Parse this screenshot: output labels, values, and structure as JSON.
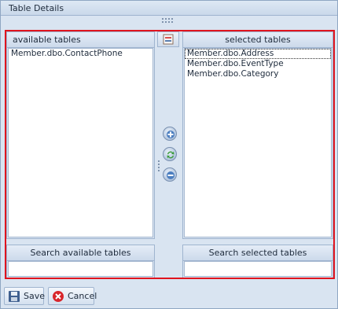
{
  "window": {
    "title": "Table Details"
  },
  "available": {
    "header": "available tables",
    "items": [
      "Member.dbo.ContactPhone"
    ],
    "search_header": "Search available tables",
    "search_value": ""
  },
  "selected": {
    "header": "selected tables",
    "items": [
      "Member.dbo.Address",
      "Member.dbo.EventType",
      "Member.dbo.Category"
    ],
    "search_header": "Search selected tables",
    "search_value": ""
  },
  "toolbar": {
    "save_label": "Save",
    "cancel_label": "Cancel"
  },
  "icons": {
    "top_button": "list-settings-icon",
    "add": "add-circle-icon",
    "swap": "swap-arrows-icon",
    "remove": "remove-circle-icon",
    "save": "floppy-disk-icon",
    "cancel": "cancel-x-icon"
  },
  "colors": {
    "highlight_border": "#e0141e",
    "background": "#d9e4f1",
    "header": "#ccdaeb"
  }
}
